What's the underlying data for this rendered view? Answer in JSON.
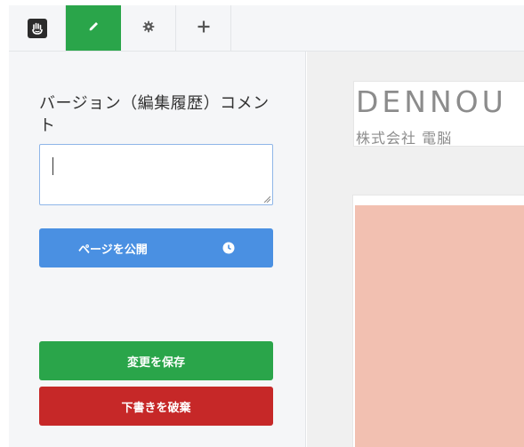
{
  "toolbar": {
    "items": [
      {
        "icon": "hand-logo-icon"
      },
      {
        "icon": "pencil-icon",
        "active": true
      },
      {
        "icon": "gear-icon"
      },
      {
        "icon": "plus-icon"
      }
    ],
    "active_color": "#2aa54a"
  },
  "panel": {
    "comment_label": "バージョン（編集履歴）コメント",
    "comment_value": "",
    "publish_label": "ページを公開",
    "publish_icon": "clock-icon",
    "save_label": "変更を保存",
    "discard_label": "下書きを破棄",
    "colors": {
      "publish": "#4a90e2",
      "save": "#2aa54a",
      "discard": "#c62828"
    }
  },
  "preview": {
    "brand_en": "DENNOU",
    "brand_jp": "株式会社 電脳",
    "hero_color": "#f2c0b1"
  }
}
